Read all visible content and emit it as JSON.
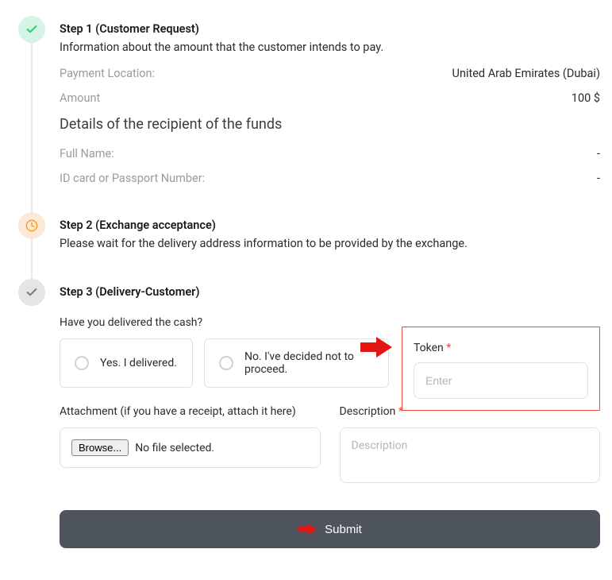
{
  "step1": {
    "title": "Step 1 (Customer Request)",
    "desc": "Information about the amount that the customer intends to pay.",
    "rows": {
      "location_label": "Payment Location:",
      "location_value": "United Arab Emirates (Dubai)",
      "amount_label": "Amount",
      "amount_value": "100 $"
    },
    "recipient_heading": "Details of the recipient of the funds",
    "recipient": {
      "fullname_label": "Full Name:",
      "fullname_value": "-",
      "id_label": "ID card or Passport Number:",
      "id_value": "-"
    }
  },
  "step2": {
    "title": "Step 2 (Exchange acceptance)",
    "desc": "Please wait for the delivery address information to be provided by the exchange."
  },
  "step3": {
    "title": "Step 3 (Delivery-Customer)",
    "question": "Have you delivered the cash?",
    "option_yes": "Yes. I delivered.",
    "option_no": "No. I've decided not to proceed.",
    "token_label": "Token ",
    "token_placeholder": "Enter",
    "attachment_label": "Attachment (if you have a receipt, attach it here)",
    "browse_label": "Browse...",
    "no_file": "No file selected.",
    "description_label": "Description ",
    "description_placeholder": "Description",
    "submit_label": "Submit"
  }
}
